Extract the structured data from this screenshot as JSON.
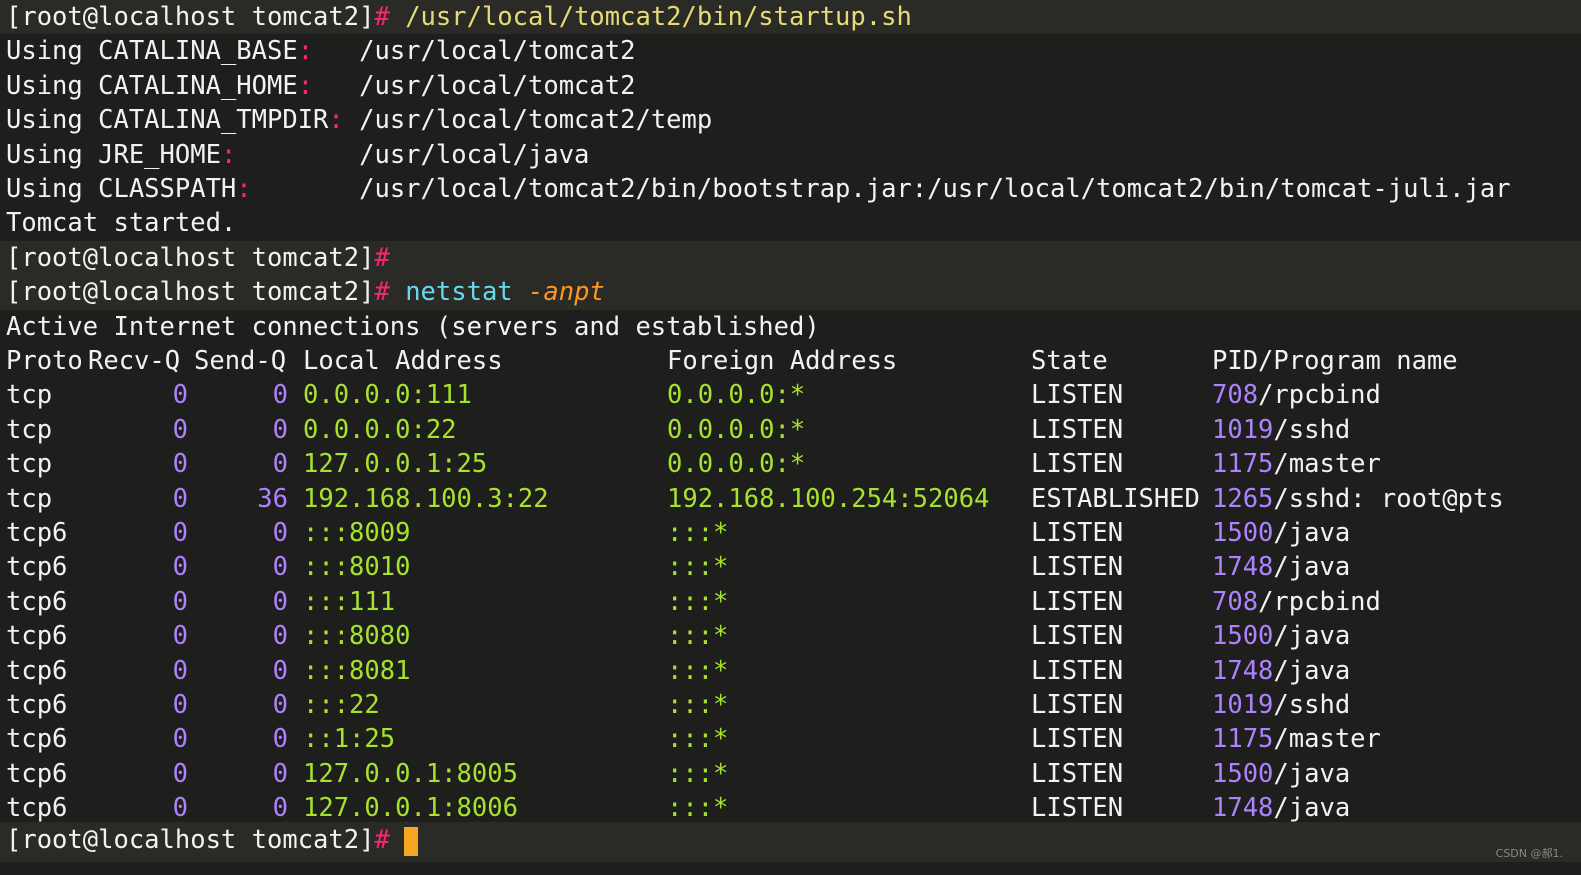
{
  "prompt": {
    "user_host": "[root@localhost tomcat2]",
    "hash": "#"
  },
  "startup": {
    "command": "/usr/local/tomcat2/bin/startup.sh",
    "lines": [
      {
        "label": "Using CATALINA_BASE",
        "sep": ":",
        "pad": "   ",
        "value": "/usr/local/tomcat2"
      },
      {
        "label": "Using CATALINA_HOME",
        "sep": ":",
        "pad": "   ",
        "value": "/usr/local/tomcat2"
      },
      {
        "label": "Using CATALINA_TMPDIR",
        "sep": ":",
        "pad": " ",
        "value": "/usr/local/tomcat2/temp"
      },
      {
        "label": "Using JRE_HOME",
        "sep": ":",
        "pad": "        ",
        "value": "/usr/local/java"
      },
      {
        "label": "Using CLASSPATH",
        "sep": ":",
        "pad": "       ",
        "value": "/usr/local/tomcat2/bin/bootstrap.jar:/usr/local/tomcat2/bin/tomcat-juli.jar"
      }
    ],
    "started": "Tomcat started."
  },
  "netstat": {
    "command": "netstat",
    "args": "-anpt",
    "title": "Active Internet connections (servers and established)",
    "headers": {
      "proto": "Proto",
      "recvq": "Recv-Q",
      "sendq": "Send-Q",
      "local": "Local Address",
      "foreign": "Foreign Address",
      "state": "State",
      "pid": "PID/Program name"
    },
    "rows": [
      {
        "proto": "tcp",
        "recvq": "0",
        "sendq": "0",
        "local": "0.0.0.0:111",
        "foreign": "0.0.0.0:*",
        "state": "LISTEN",
        "pid": "708",
        "prog": "/rpcbind"
      },
      {
        "proto": "tcp",
        "recvq": "0",
        "sendq": "0",
        "local": "0.0.0.0:22",
        "foreign": "0.0.0.0:*",
        "state": "LISTEN",
        "pid": "1019",
        "prog": "/sshd"
      },
      {
        "proto": "tcp",
        "recvq": "0",
        "sendq": "0",
        "local": "127.0.0.1:25",
        "foreign": "0.0.0.0:*",
        "state": "LISTEN",
        "pid": "1175",
        "prog": "/master"
      },
      {
        "proto": "tcp",
        "recvq": "0",
        "sendq": "36",
        "local": "192.168.100.3:22",
        "foreign": "192.168.100.254:52064",
        "state": "ESTABLISHED",
        "pid": "1265",
        "prog": "/sshd: root@pts"
      },
      {
        "proto": "tcp6",
        "recvq": "0",
        "sendq": "0",
        "local": ":::8009",
        "foreign": ":::*",
        "state": "LISTEN",
        "pid": "1500",
        "prog": "/java"
      },
      {
        "proto": "tcp6",
        "recvq": "0",
        "sendq": "0",
        "local": ":::8010",
        "foreign": ":::*",
        "state": "LISTEN",
        "pid": "1748",
        "prog": "/java"
      },
      {
        "proto": "tcp6",
        "recvq": "0",
        "sendq": "0",
        "local": ":::111",
        "foreign": ":::*",
        "state": "LISTEN",
        "pid": "708",
        "prog": "/rpcbind"
      },
      {
        "proto": "tcp6",
        "recvq": "0",
        "sendq": "0",
        "local": ":::8080",
        "foreign": ":::*",
        "state": "LISTEN",
        "pid": "1500",
        "prog": "/java"
      },
      {
        "proto": "tcp6",
        "recvq": "0",
        "sendq": "0",
        "local": ":::8081",
        "foreign": ":::*",
        "state": "LISTEN",
        "pid": "1748",
        "prog": "/java"
      },
      {
        "proto": "tcp6",
        "recvq": "0",
        "sendq": "0",
        "local": ":::22",
        "foreign": ":::*",
        "state": "LISTEN",
        "pid": "1019",
        "prog": "/sshd"
      },
      {
        "proto": "tcp6",
        "recvq": "0",
        "sendq": "0",
        "local": "::1:25",
        "foreign": ":::*",
        "state": "LISTEN",
        "pid": "1175",
        "prog": "/master"
      },
      {
        "proto": "tcp6",
        "recvq": "0",
        "sendq": "0",
        "local": "127.0.0.1:8005",
        "foreign": ":::*",
        "state": "LISTEN",
        "pid": "1500",
        "prog": "/java"
      },
      {
        "proto": "tcp6",
        "recvq": "0",
        "sendq": "0",
        "local": "127.0.0.1:8006",
        "foreign": ":::*",
        "state": "LISTEN",
        "pid": "1748",
        "prog": "/java"
      }
    ]
  },
  "watermark": "CSDN @郝1."
}
